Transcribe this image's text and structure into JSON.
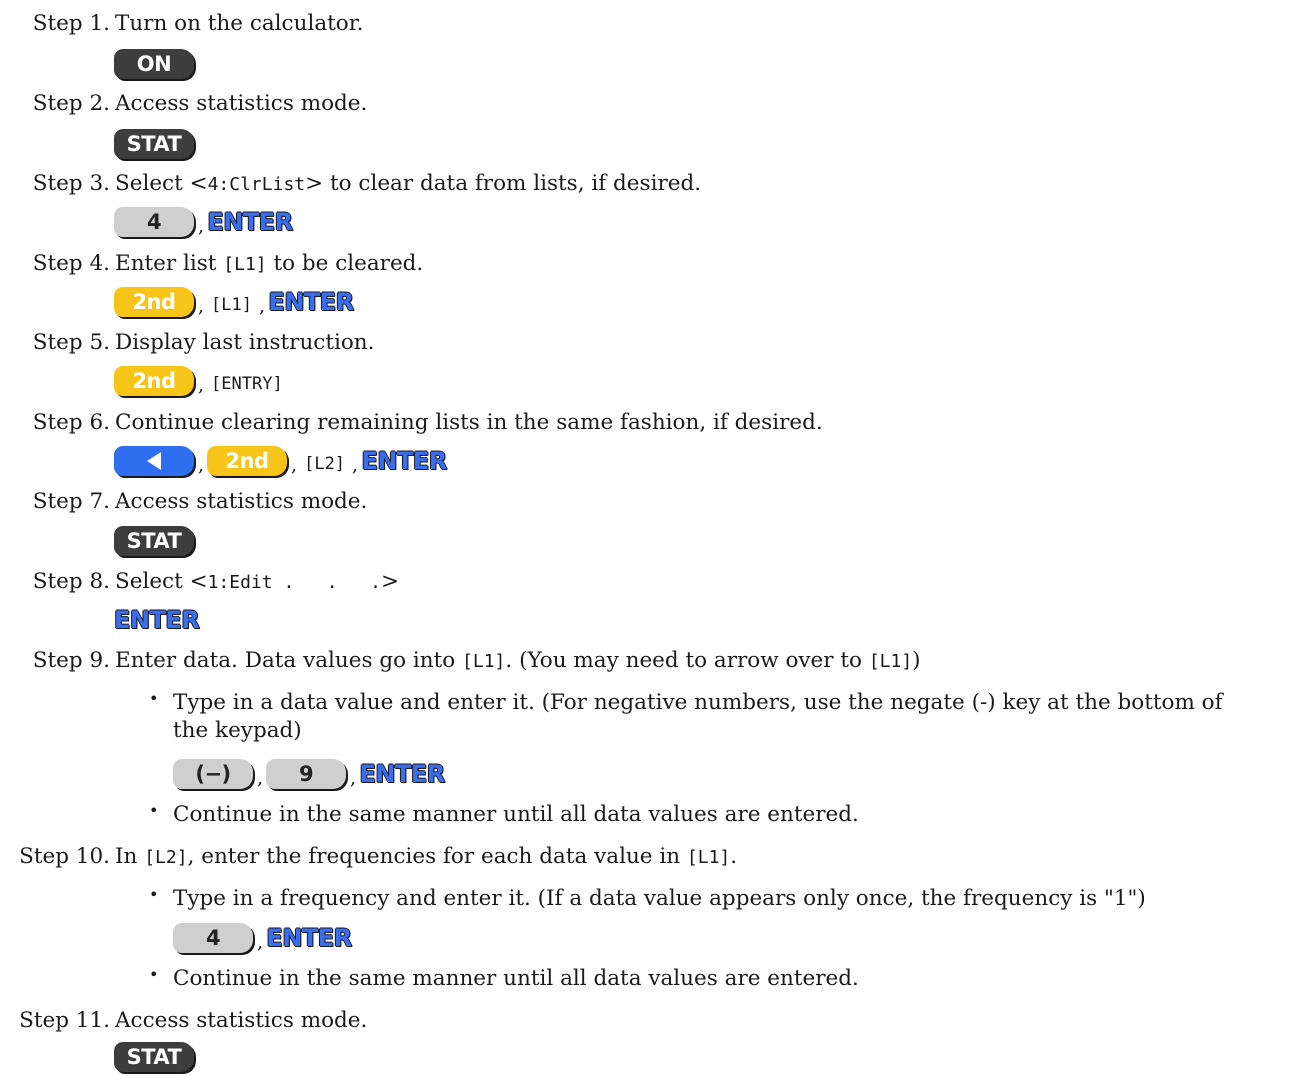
{
  "steps": [
    {
      "label": "Step 1.",
      "text": "Turn on the calculator."
    },
    {
      "label": "Step 2.",
      "text": "Access statistics mode."
    },
    {
      "label": "Step 3.",
      "pre": "Select ",
      "lt": "<",
      "code": "4:ClrList",
      "gt": ">",
      "post": " to clear data from lists, if desired."
    },
    {
      "label": "Step 4.",
      "pre": "Enter list ",
      "code": "[L1]",
      "post": " to be cleared."
    },
    {
      "label": "Step 5.",
      "text": "Display last instruction."
    },
    {
      "label": "Step 6.",
      "text": "Continue clearing remaining lists in the same fashion, if desired."
    },
    {
      "label": "Step 7.",
      "text": "Access statistics mode."
    },
    {
      "label": "Step 8.",
      "pre": "Select ",
      "lt": "<",
      "code": "1:Edit .   .   .",
      "gt": ">"
    },
    {
      "label": "Step 9.",
      "pre": "Enter data. Data values go into ",
      "code": "[L1]",
      "mid": ". (You may need to arrow over to ",
      "code2": "[L1]",
      "post": ")"
    },
    {
      "label": "Step 10.",
      "pre": "In ",
      "code": "[L2]",
      "mid": ", enter the frequencies for each data value in ",
      "code2": "[L1]",
      "post": "."
    },
    {
      "label": "Step 11.",
      "text": "Access statistics mode."
    }
  ],
  "bullets": {
    "step9_a_line1": "Type in a data value and enter it. (For negative numbers, use the negate (-) key at the bottom of",
    "step9_a_line2": "the keypad)",
    "step9_b": "Continue in the same manner until all data values are entered.",
    "step10_a": "Type in a frequency and enter it. (If a data value appears only once, the frequency is \"1\")",
    "step10_b": "Continue in the same manner until all data values are entered.",
    "bullet_symbol": "•"
  },
  "keys": {
    "on": "ON",
    "stat": "STAT",
    "four": "4",
    "enter": "ENTER",
    "second": "2nd",
    "negate": "(−)",
    "nine": "9",
    "left_arrow": "left-arrow-icon"
  },
  "inline": {
    "comma": ",",
    "l1": "[L1]",
    "l2": "[L2]",
    "entry": "[ENTRY]"
  },
  "colors": {
    "dark_key": "#3d3d3d",
    "gray_key": "#cfcfcf",
    "yellow_key": "#f7c518",
    "blue_key": "#2f6ef0",
    "enter_text": "#3a6ef0"
  }
}
